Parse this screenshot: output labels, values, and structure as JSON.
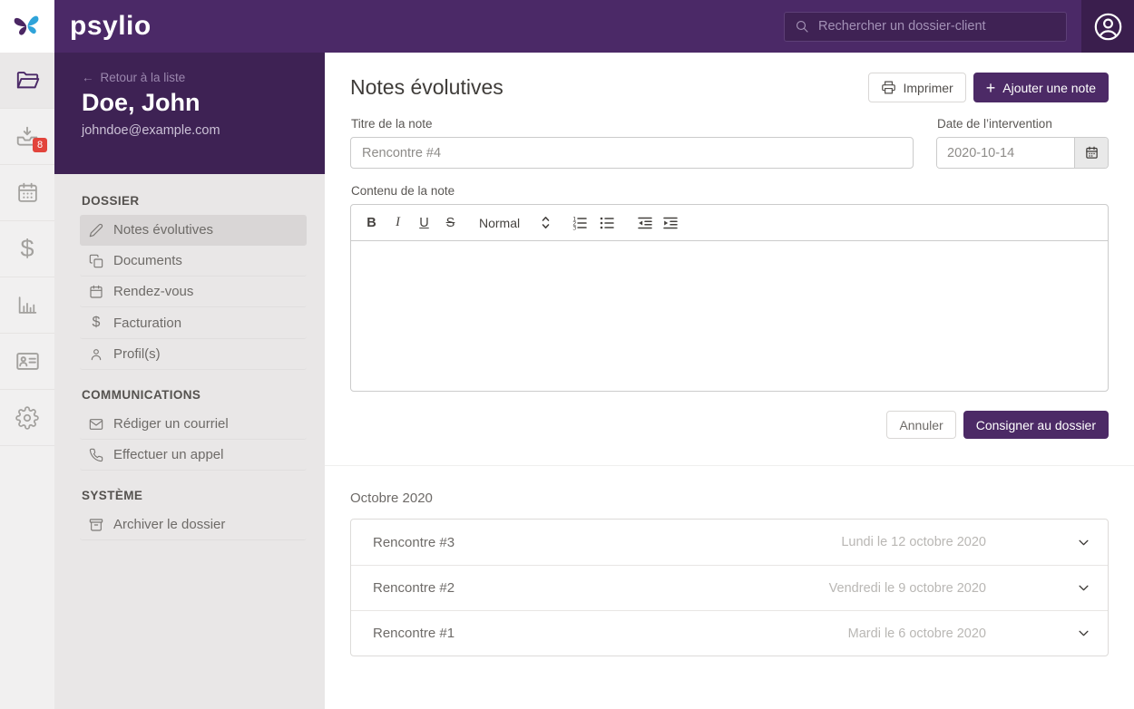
{
  "colors": {
    "brand_purple": "#4b2967",
    "brand_purple_dark": "#3e2254",
    "search_field_purple": "#3f2254",
    "account_square_purple": "#3a1e4d",
    "accent_blue": "#2fa3d9",
    "badge_red": "#e2443c",
    "primary_button_purple": "#4c2a66",
    "sidebar_gray": "#e9e7e7",
    "active_item_gray": "#d9d6d6"
  },
  "topbar": {
    "brand": "psylio",
    "search_placeholder": "Rechercher un dossier-client"
  },
  "rail": {
    "inbox_badge": "8",
    "dollar_glyph": "$"
  },
  "sidebar": {
    "back_arrow": "←",
    "back_label": "Retour à la liste",
    "client_name": "Doe, John",
    "client_email": "johndoe@example.com",
    "dollar_glyph": "$",
    "sections": [
      {
        "title": "DOSSIER",
        "items": [
          {
            "label": "Notes évolutives"
          },
          {
            "label": "Documents"
          },
          {
            "label": "Rendez-vous"
          },
          {
            "label": "Facturation"
          },
          {
            "label": "Profil(s)"
          }
        ]
      },
      {
        "title": "COMMUNICATIONS",
        "items": [
          {
            "label": "Rédiger un courriel"
          },
          {
            "label": "Effectuer un appel"
          }
        ]
      },
      {
        "title": "SYSTÈME",
        "items": [
          {
            "label": "Archiver le dossier"
          }
        ]
      }
    ]
  },
  "main": {
    "title": "Notes évolutives",
    "print_label": "Imprimer",
    "add_note_label": "Ajouter une note",
    "add_note_plus": "+",
    "form": {
      "title_label": "Titre de la note",
      "title_value": "Rencontre #4",
      "date_label": "Date de l’intervention",
      "date_value": "2020-10-14",
      "content_label": "Contenu de la note"
    },
    "editor": {
      "bold": "B",
      "italic": "I",
      "underline": "U",
      "strike": "S",
      "format_value": "Normal"
    },
    "cancel_label": "Annuler",
    "submit_label": "Consigner au dossier",
    "notes": {
      "group_title": "Octobre 2020",
      "items": [
        {
          "title": "Rencontre #3",
          "date": "Lundi le 12 octobre 2020"
        },
        {
          "title": "Rencontre #2",
          "date": "Vendredi le 9 octobre 2020"
        },
        {
          "title": "Rencontre #1",
          "date": "Mardi le 6 octobre 2020"
        }
      ]
    }
  }
}
